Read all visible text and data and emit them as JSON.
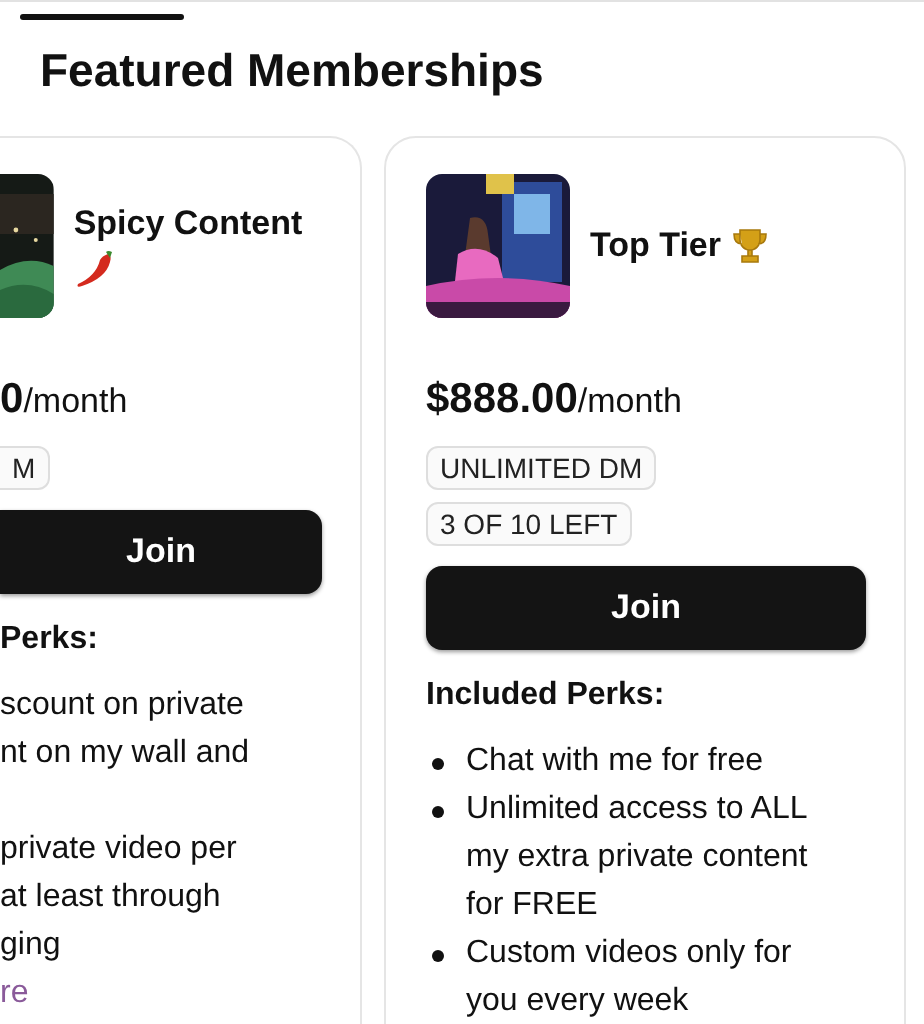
{
  "heading": "Featured Memberships",
  "memberships": [
    {
      "kind": "cut",
      "name": "Spicy Content",
      "price": "0",
      "period": "/month",
      "badges": [
        "M"
      ],
      "join": "Join",
      "perks_heading": "Perks:",
      "perks": [
        {
          "lines": [
            "scount on private",
            "nt on my wall and"
          ]
        },
        {
          "lines": [
            "private video per",
            "at least through",
            "ging"
          ]
        }
      ],
      "more_link": "re"
    },
    {
      "kind": "full",
      "name": "Top Tier",
      "price": "$888.00",
      "period": "/month",
      "badges": [
        "UNLIMITED DM",
        "3 OF 10 LEFT"
      ],
      "join": "Join",
      "perks_heading": "Included Perks:",
      "perks": [
        {
          "lines": [
            "Chat with me for free"
          ]
        },
        {
          "lines": [
            "Unlimited access to ALL my extra private content for FREE"
          ]
        },
        {
          "lines": [
            "Custom videos only for you every week"
          ]
        }
      ]
    }
  ]
}
